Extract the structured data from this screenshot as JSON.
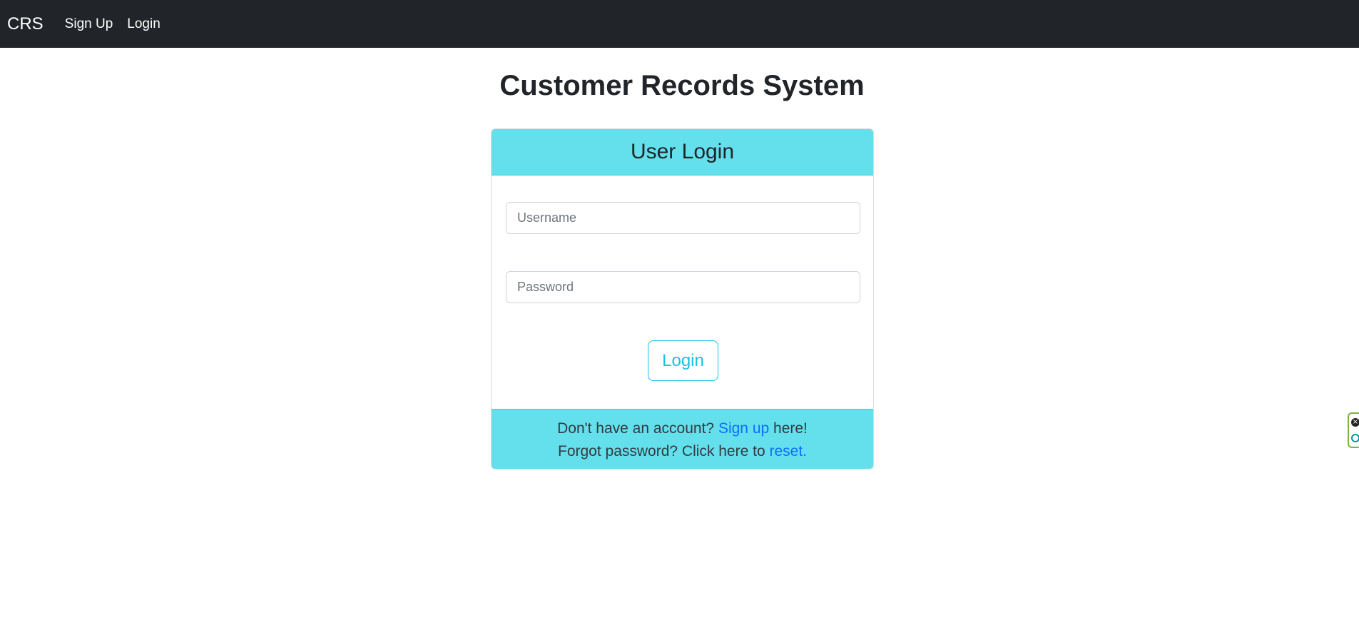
{
  "nav": {
    "brand": "CRS",
    "links": [
      "Sign Up",
      "Login"
    ]
  },
  "page": {
    "title": "Customer Records System"
  },
  "login_card": {
    "header": "User Login",
    "username_placeholder": "Username",
    "password_placeholder": "Password",
    "login_button": "Login",
    "footer": {
      "line1_prefix": "Don't have an account? ",
      "line1_link": "Sign up",
      "line1_suffix": " here!",
      "line2_prefix": "Forgot password? Click here to ",
      "line2_link": "reset",
      "line2_suffix": "."
    }
  },
  "colors": {
    "navbar": "#212529",
    "card_accent": "#64dfec",
    "button_outline": "#17c1e8",
    "link": "#0d6efd"
  }
}
